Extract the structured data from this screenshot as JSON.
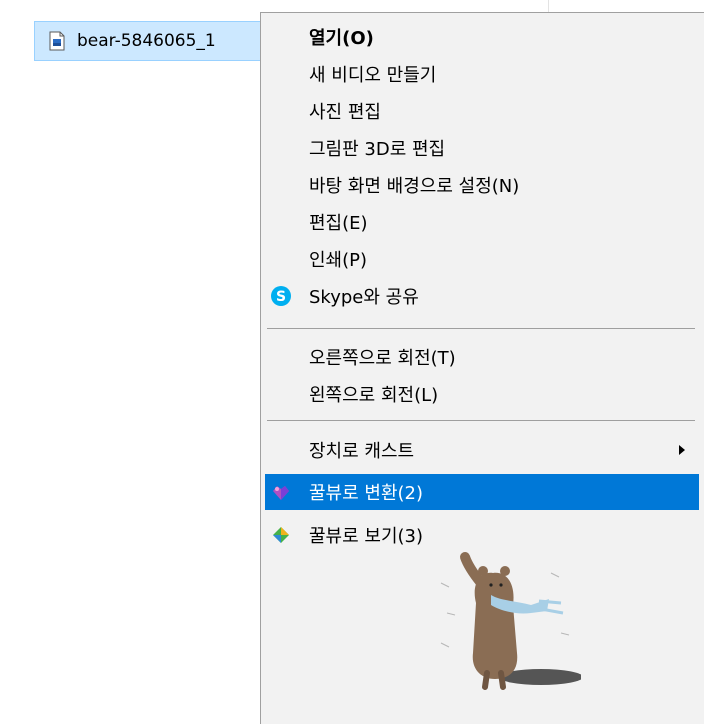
{
  "explorer": {
    "file_name": "bear-5846065_1"
  },
  "context_menu": {
    "items": [
      {
        "label": "열기(O)"
      },
      {
        "label": "새 비디오 만들기"
      },
      {
        "label": "사진 편집"
      },
      {
        "label": "그림판 3D로 편집"
      },
      {
        "label": "바탕 화면 배경으로 설정(N)"
      },
      {
        "label": "편집(E)"
      },
      {
        "label": "인쇄(P)"
      },
      {
        "label": "Skype와 공유",
        "icon": "skype-icon"
      },
      {
        "label": "오른쪽으로 회전(T)"
      },
      {
        "label": "왼쪽으로 회전(L)"
      },
      {
        "label": "장치로 캐스트",
        "submenu": true
      },
      {
        "label": "꿀뷰로 변환(2)",
        "icon": "honeyview-convert-icon",
        "highlighted": true
      },
      {
        "label": "꿀뷰로 보기(3)",
        "icon": "honeyview-view-icon"
      }
    ]
  },
  "colors": {
    "highlight": "#0078d7",
    "selection": "#cce8ff",
    "menu_bg": "#f2f2f2",
    "skype": "#00aff0"
  }
}
